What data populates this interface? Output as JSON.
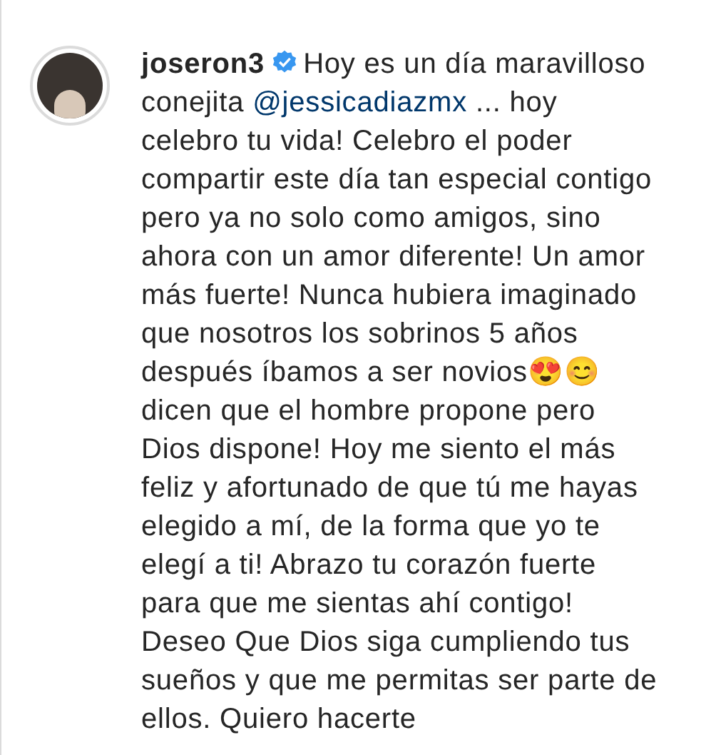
{
  "post": {
    "username": "joseron3",
    "verified": true,
    "caption_parts": [
      {
        "kind": "text",
        "text": "Hoy es un día maravilloso conejita "
      },
      {
        "kind": "mention",
        "text": "@jessicadiazmx"
      },
      {
        "kind": "text",
        "text": " ... hoy celebro tu vida! Celebro el poder compartir este día tan especial contigo pero ya no solo como amigos, sino ahora con un amor diferente! Un amor más fuerte! Nunca hubiera imaginado que nosotros los sobrinos 5 años después íbamos a ser novios😍😊 dicen que el hombre propone pero Dios dispone! Hoy me siento el más feliz y afortunado de que tú me hayas elegido a mí, de la forma que yo te elegí a ti! Abrazo tu corazón fuerte para que me sientas ahí contigo! Deseo Que Dios siga cumpliendo tus sueños y que me permitas ser parte de ellos. Quiero hacerte"
      }
    ]
  }
}
